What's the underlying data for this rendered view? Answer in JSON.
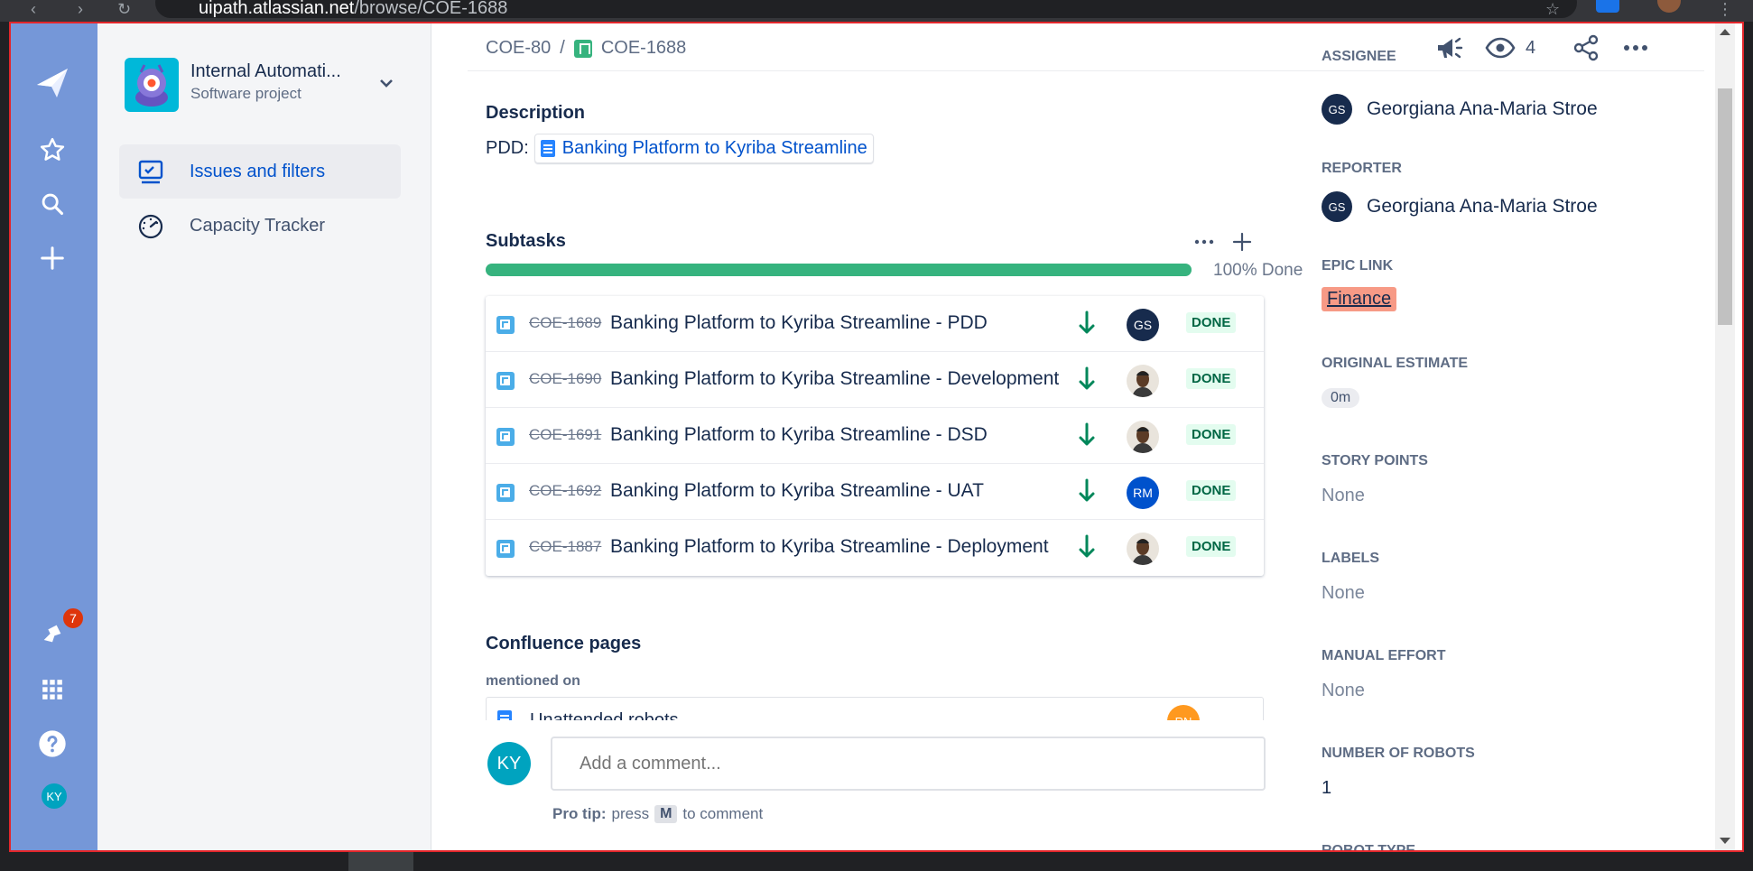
{
  "browser": {
    "url_host": "uipath.atlassian.net",
    "url_path": "/browse/COE-1688"
  },
  "global_nav": {
    "notification_count": "7",
    "user_initials": "KY"
  },
  "project": {
    "name": "Internal Automati...",
    "type": "Software project",
    "nav_items": [
      {
        "label": "Issues and filters",
        "icon": "issues-icon",
        "active": true
      },
      {
        "label": "Capacity Tracker",
        "icon": "speedometer-icon",
        "active": false
      }
    ]
  },
  "breadcrumb": {
    "parent": "COE-80",
    "separator": "/",
    "current": "COE-1688"
  },
  "toolbar": {
    "watch_count": "4"
  },
  "description": {
    "title": "Description",
    "prefix": "PDD:",
    "link_text": "Banking Platform to Kyriba Streamline"
  },
  "subtasks": {
    "title": "Subtasks",
    "progress_percent": 100,
    "progress_label": "100% Done",
    "items": [
      {
        "key": "COE-1689",
        "summary": "Banking Platform to Kyriba Streamline - PDD",
        "assignee": "GS",
        "assignee_type": "initials",
        "status": "DONE"
      },
      {
        "key": "COE-1690",
        "summary": "Banking Platform to Kyriba Streamline - Development",
        "assignee": "",
        "assignee_type": "photo",
        "status": "DONE"
      },
      {
        "key": "COE-1691",
        "summary": "Banking Platform to Kyriba Streamline - DSD",
        "assignee": "",
        "assignee_type": "photo",
        "status": "DONE"
      },
      {
        "key": "COE-1692",
        "summary": "Banking Platform to Kyriba Streamline - UAT",
        "assignee": "RM",
        "assignee_type": "initials-blue",
        "status": "DONE"
      },
      {
        "key": "COE-1887",
        "summary": "Banking Platform to Kyriba Streamline - Deployment",
        "assignee": "",
        "assignee_type": "photo",
        "status": "DONE"
      }
    ]
  },
  "confluence": {
    "title": "Confluence pages",
    "subtitle": "mentioned on",
    "page_title": "Unattended robots",
    "page_author": "RN"
  },
  "comment": {
    "user_initials": "KY",
    "placeholder": "Add a comment...",
    "protip_bold": "Pro tip:",
    "protip_press": "press",
    "protip_key": "M",
    "protip_rest": "to comment"
  },
  "details": {
    "assignee_label": "ASSIGNEE",
    "assignee_initials": "GS",
    "assignee_name": "Georgiana Ana-Maria Stroe",
    "reporter_label": "REPORTER",
    "reporter_initials": "GS",
    "reporter_name": "Georgiana Ana-Maria Stroe",
    "epic_label": "EPIC LINK",
    "epic_value": "Finance",
    "estimate_label": "ORIGINAL ESTIMATE",
    "estimate_value": "0m",
    "story_points_label": "STORY POINTS",
    "story_points_value": "None",
    "labels_label": "LABELS",
    "labels_value": "None",
    "manual_effort_label": "MANUAL EFFORT",
    "manual_effort_value": "None",
    "robots_label": "NUMBER OF ROBOTS",
    "robots_value": "1",
    "robot_type_label": "ROBOT TYPE"
  },
  "colors": {
    "global_nav": "#7597d8",
    "done_green": "#36b37e",
    "link_blue": "#0052cc",
    "epic_bg": "#f79a86",
    "frame_red": "#e3262b"
  }
}
